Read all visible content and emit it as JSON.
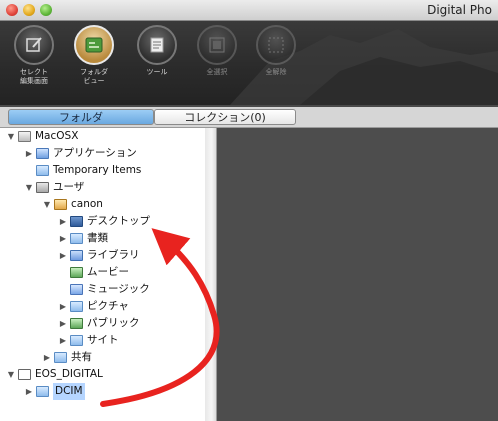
{
  "window": {
    "title": "Digital Pho"
  },
  "toolbar": {
    "buttons": [
      {
        "label": "セレクト\n編集画面",
        "icon": "edit-select-icon"
      },
      {
        "label": "フォルダ\nビュー",
        "icon": "folder-view-icon"
      },
      {
        "label": "ツール",
        "icon": "tools-icon"
      },
      {
        "label": "全選択",
        "icon": "select-all-icon"
      },
      {
        "label": "全解除",
        "icon": "deselect-all-icon"
      }
    ]
  },
  "tabs": [
    {
      "label": "フォルダ",
      "active": true
    },
    {
      "label": "コレクション(0)",
      "active": false
    }
  ],
  "tree": [
    {
      "label": "MacOSX",
      "arrow": "▼",
      "icon": "drive-icon"
    },
    {
      "label": "アプリケーション",
      "arrow": "▶",
      "icon": "applications-folder-icon"
    },
    {
      "label": "Temporary Items",
      "arrow": "",
      "icon": "folder-icon"
    },
    {
      "label": "ユーザ",
      "arrow": "▼",
      "icon": "users-folder-icon"
    },
    {
      "label": "canon",
      "arrow": "▼",
      "icon": "home-folder-icon"
    },
    {
      "label": "デスクトップ",
      "arrow": "▶",
      "icon": "desktop-folder-icon"
    },
    {
      "label": "書類",
      "arrow": "▶",
      "icon": "documents-folder-icon"
    },
    {
      "label": "ライブラリ",
      "arrow": "▶",
      "icon": "library-folder-icon"
    },
    {
      "label": "ムービー",
      "arrow": "",
      "icon": "movies-folder-icon"
    },
    {
      "label": "ミュージック",
      "arrow": "",
      "icon": "music-folder-icon"
    },
    {
      "label": "ピクチャ",
      "arrow": "▶",
      "icon": "pictures-folder-icon"
    },
    {
      "label": "パブリック",
      "arrow": "▶",
      "icon": "public-folder-icon"
    },
    {
      "label": "サイト",
      "arrow": "▶",
      "icon": "sites-folder-icon"
    },
    {
      "label": "共有",
      "arrow": "▶",
      "icon": "shared-folder-icon"
    },
    {
      "label": "EOS_DIGITAL",
      "arrow": "▼",
      "icon": "removable-disk-icon"
    },
    {
      "label": "DCIM",
      "arrow": "▶",
      "icon": "folder-icon"
    }
  ],
  "annotation": {
    "color": "#e8231f"
  },
  "colors": {
    "tab_active": "#7fb8ea",
    "selection": "#b5d5ff",
    "preview_bg": "#4d4d4d"
  }
}
